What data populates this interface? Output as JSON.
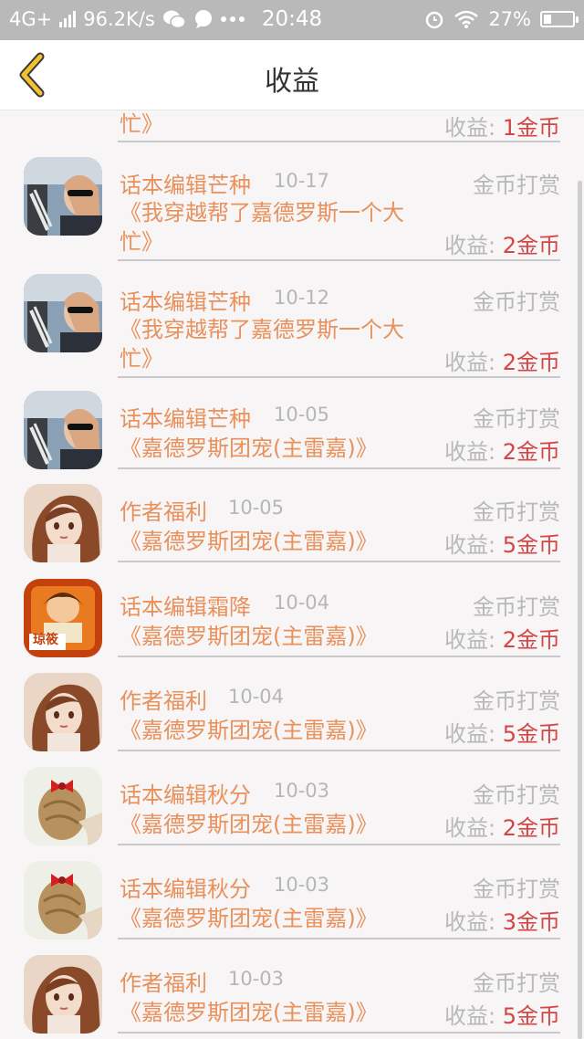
{
  "status_bar": {
    "network": "4G+",
    "speed": "96.2K/s",
    "time": "20:48",
    "battery": "27%",
    "battery_level": 0.27
  },
  "header": {
    "title": "收益"
  },
  "earn_label": "收益:",
  "records": [
    {
      "book_lines": [
        "忙》"
      ],
      "earning": "1金币"
    },
    {
      "name": "话本编辑芒种",
      "date": "10-17",
      "type": "金币打赏",
      "book_lines": [
        "《我穿越帮了嘉德罗斯一个大",
        "忙》"
      ],
      "earning": "2金币",
      "avatar": "photo-girl"
    },
    {
      "name": "话本编辑芒种",
      "date": "10-12",
      "type": "金币打赏",
      "book_lines": [
        "《我穿越帮了嘉德罗斯一个大",
        "忙》"
      ],
      "earning": "2金币",
      "avatar": "photo-girl"
    },
    {
      "name": "话本编辑芒种",
      "date": "10-05",
      "type": "金币打赏",
      "book_lines": [
        "《嘉德罗斯团宠(主雷嘉)》"
      ],
      "earning": "2金币",
      "avatar": "photo-girl"
    },
    {
      "name": "作者福利",
      "date": "10-05",
      "type": "金币打赏",
      "book_lines": [
        "《嘉德罗斯团宠(主雷嘉)》"
      ],
      "earning": "5金币",
      "avatar": "anime-girl"
    },
    {
      "name": "话本编辑霜降",
      "date": "10-04",
      "type": "金币打赏",
      "book_lines": [
        "《嘉德罗斯团宠(主雷嘉)》"
      ],
      "earning": "2金币",
      "avatar": "orange-card",
      "avatar_text": "琼筱"
    },
    {
      "name": "作者福利",
      "date": "10-04",
      "type": "金币打赏",
      "book_lines": [
        "《嘉德罗斯团宠(主雷嘉)》"
      ],
      "earning": "5金币",
      "avatar": "anime-girl"
    },
    {
      "name": "话本编辑秋分",
      "date": "10-03",
      "type": "金币打赏",
      "book_lines": [
        "《嘉德罗斯团宠(主雷嘉)》"
      ],
      "earning": "2金币",
      "avatar": "hair-bow"
    },
    {
      "name": "话本编辑秋分",
      "date": "10-03",
      "type": "金币打赏",
      "book_lines": [
        "《嘉德罗斯团宠(主雷嘉)》"
      ],
      "earning": "3金币",
      "avatar": "hair-bow"
    },
    {
      "name": "作者福利",
      "date": "10-03",
      "type": "金币打赏",
      "book_lines": [
        "《嘉德罗斯团宠(主雷嘉)》"
      ],
      "earning": "5金币",
      "avatar": "anime-girl"
    }
  ]
}
